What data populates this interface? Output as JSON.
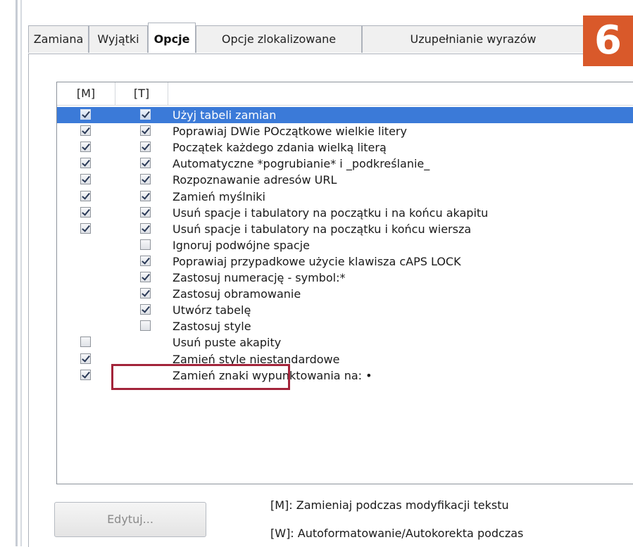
{
  "tabs": [
    {
      "label": "Zamiana"
    },
    {
      "label": "Wyjątki"
    },
    {
      "label": "Opcje"
    },
    {
      "label": "Opcje zlokalizowane"
    },
    {
      "label": "Uzupełnianie wyrazów"
    }
  ],
  "step_badge": "6",
  "list": {
    "col_m": "[M]",
    "col_t": "[T]",
    "items": [
      {
        "label": "Użyj tabeli zamian",
        "m": true,
        "t": true,
        "selected": true
      },
      {
        "label": "Poprawiaj DWie POczątkowe wielkie litery",
        "m": true,
        "t": true
      },
      {
        "label": "Początek każdego zdania wielką literą",
        "m": true,
        "t": true
      },
      {
        "label": "Automatyczne *pogrubianie* i _podkreślanie_",
        "m": true,
        "t": true
      },
      {
        "label": "Rozpoznawanie adresów URL",
        "m": true,
        "t": true
      },
      {
        "label": "Zamień myślniki",
        "m": true,
        "t": true
      },
      {
        "label": "Usuń spacje i tabulatory na początku i na końcu akapitu",
        "m": true,
        "t": true
      },
      {
        "label": "Usuń spacje i tabulatory na początku i końcu wiersza",
        "m": true,
        "t": true
      },
      {
        "label": "Ignoruj podwójne spacje",
        "m": null,
        "t": false
      },
      {
        "label": "Poprawiaj przypadkowe użycie klawisza cAPS LOCK",
        "m": null,
        "t": true
      },
      {
        "label": "Zastosuj numerację - symbol:*",
        "m": null,
        "t": true
      },
      {
        "label": "Zastosuj obramowanie",
        "m": null,
        "t": true
      },
      {
        "label": "Utwórz tabelę",
        "m": null,
        "t": true,
        "highlighted": true
      },
      {
        "label": "Zastosuj style",
        "m": null,
        "t": false
      },
      {
        "label": "Usuń puste akapity",
        "m": false,
        "t": null
      },
      {
        "label": "Zamień style niestandardowe",
        "m": true,
        "t": null
      },
      {
        "label": "Zamień znaki wypunktowania na: •",
        "m": true,
        "t": null
      }
    ]
  },
  "edit_button": "Edytuj...",
  "legend": {
    "m": "[M]: Zamieniaj podczas modyfikacji tekstu",
    "w": "[W]: Autoformatowanie/Autokorekta podczas"
  }
}
